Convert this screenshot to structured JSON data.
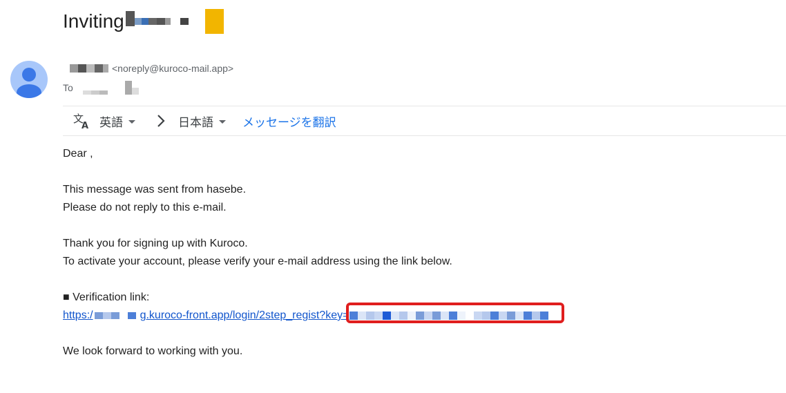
{
  "email": {
    "subject": "Inviting",
    "sender_email": "<noreply@kuroco-mail.app>",
    "to_label": "To"
  },
  "translate_bar": {
    "source_language": "英語",
    "target_language": "日本語",
    "translate_link": "メッセージを翻訳",
    "icons": [
      "translate-icon",
      "chevron-right-icon",
      "caret-down-icon"
    ]
  },
  "body": {
    "greeting": "Dear ,",
    "line1": "This message was sent from hasebe.",
    "line2": "Please do not reply to this e-mail.",
    "line3": "Thank you for signing up with Kuroco.",
    "line4": "To activate your account, please verify your e-mail address using the link below.",
    "verification_label": "■ Verification link:",
    "link_prefix": "https:/",
    "link_suffix": "g.kuroco-front.app/login/2step_regist?key=",
    "closing": "We look forward to working with you."
  },
  "colors": {
    "link": "#1155cc",
    "translate_link": "#1a73e8",
    "highlight": "#e01e1e",
    "avatar": "#a8c7fa",
    "avatar_figure": "#3b78e7"
  }
}
